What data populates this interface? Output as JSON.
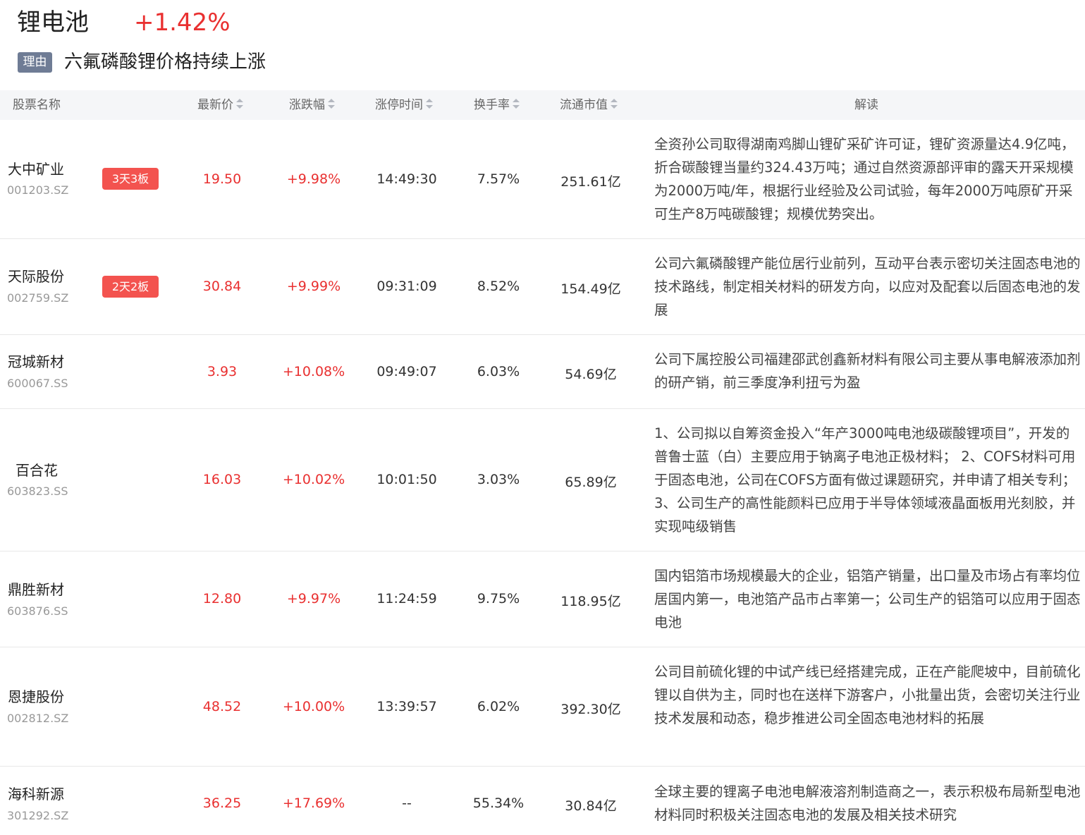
{
  "header": {
    "sector_name": "锂电池",
    "sector_change": "+1.42%",
    "reason_tag": "理由",
    "reason_text": "六氟磷酸锂价格持续上涨"
  },
  "columns": {
    "name": "股票名称",
    "price": "最新价",
    "change": "涨跌幅",
    "limit_time": "涨停时间",
    "turnover": "换手率",
    "market_cap": "流通市值",
    "analysis": "解读"
  },
  "colors": {
    "up": "#e93030",
    "badge": "#f3534f",
    "tag": "#6f7c95"
  },
  "rows": [
    {
      "name": "大中矿业",
      "code": "001203.SZ",
      "badge": "3天3板",
      "price": "19.50",
      "change": "+9.98%",
      "time": "14:49:30",
      "turnover": "7.57%",
      "market_cap": "251.61亿",
      "desc": "全资孙公司取得湖南鸡脚山锂矿采矿许可证，锂矿资源量达4.9亿吨，折合碳酸锂当量约324.43万吨；通过自然资源部评审的露天开采规模为2000万吨/年，根据行业经验及公司试验，每年2000万吨原矿开采可生产8万吨碳酸锂；规模优势突出。"
    },
    {
      "name": "天际股份",
      "code": "002759.SZ",
      "badge": "2天2板",
      "price": "30.84",
      "change": "+9.99%",
      "time": "09:31:09",
      "turnover": "8.52%",
      "market_cap": "154.49亿",
      "desc": "公司六氟磷酸锂产能位居行业前列，互动平台表示密切关注固态电池的技术路线，制定相关材料的研发方向，以应对及配套以后固态电池的发展"
    },
    {
      "name": "冠城新材",
      "code": "600067.SS",
      "badge": "",
      "price": "3.93",
      "change": "+10.08%",
      "time": "09:49:07",
      "turnover": "6.03%",
      "market_cap": "54.69亿",
      "desc": "公司下属控股公司福建邵武创鑫新材料有限公司主要从事电解液添加剂的研产销，前三季度净利扭亏为盈"
    },
    {
      "name": "百合花",
      "code": "603823.SS",
      "badge": "",
      "price": "16.03",
      "change": "+10.02%",
      "time": "10:01:50",
      "turnover": "3.03%",
      "market_cap": "65.89亿",
      "desc": "1、公司拟以自筹资金投入“年产3000吨电池级碳酸锂项目”，开发的普鲁士蓝（白）主要应用于钠离子电池正极材料； 2、COFS材料可用于固态电池，公司在COFS方面有做过课题研究，并申请了相关专利； 3、公司生产的高性能颜料已应用于半导体领域液晶面板用光刻胶，并实现吨级销售"
    },
    {
      "name": "鼎胜新材",
      "code": "603876.SS",
      "badge": "",
      "price": "12.80",
      "change": "+9.97%",
      "time": "11:24:59",
      "turnover": "9.75%",
      "market_cap": "118.95亿",
      "desc": "国内铝箔市场规模最大的企业，铝箔产销量，出口量及市场占有率均位居国内第一，电池箔产品市占率第一；公司生产的铝箔可以应用于固态电池"
    },
    {
      "name": "恩捷股份",
      "code": "002812.SZ",
      "badge": "",
      "price": "48.52",
      "change": "+10.00%",
      "time": "13:39:57",
      "turnover": "6.02%",
      "market_cap": "392.30亿",
      "desc": "公司目前硫化锂的中试产线已经搭建完成，正在产能爬坡中，目前硫化锂以自供为主，同时也在送样下游客户，小批量出货，会密切关注行业技术发展和动态，稳步推进公司全固态电池材料的拓展"
    },
    {
      "name": "海科新源",
      "code": "301292.SZ",
      "badge": "",
      "price": "36.25",
      "change": "+17.69%",
      "time": "--",
      "turnover": "55.34%",
      "market_cap": "30.84亿",
      "desc": "全球主要的锂离子电池电解液溶剂制造商之一，表示积极布局新型电池材料同时积极关注固态电池的发展及相关技术研究"
    }
  ]
}
